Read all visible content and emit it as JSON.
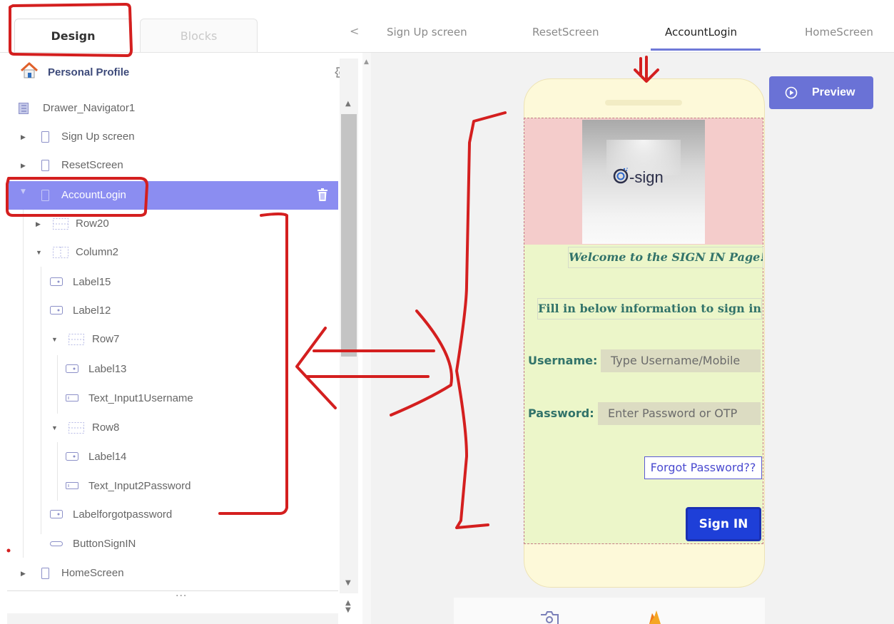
{
  "editor_tabs": {
    "design": "Design",
    "blocks": "Blocks"
  },
  "screen_tabs": {
    "prev_arrow": "<",
    "items": [
      {
        "label": "Sign Up screen"
      },
      {
        "label": "ResetScreen"
      },
      {
        "label": "AccountLogin"
      },
      {
        "label": "HomeScreen"
      }
    ]
  },
  "project": {
    "title": "Personal Profile"
  },
  "tree": {
    "drawer": "Drawer_Navigator1",
    "signup": "Sign Up screen",
    "reset": "ResetScreen",
    "account": "AccountLogin",
    "row20": "Row20",
    "column2": "Column2",
    "label15": "Label15",
    "label12": "Label12",
    "row7": "Row7",
    "label13": "Label13",
    "text1": "Text_Input1Username",
    "row8": "Row8",
    "label14": "Label14",
    "text2": "Text_Input2Password",
    "labelforgot": "Labelforgotpassword",
    "button": "ButtonSignIN",
    "home": "HomeScreen"
  },
  "panel": {
    "more": "..."
  },
  "preview": {
    "label": "Preview"
  },
  "phone": {
    "logo_text": "-sign",
    "welcome": "Welcome to the SIGN IN Page!",
    "fill_in": "Fill in below information to sign in",
    "username_label": "Username:",
    "username_placeholder": "Type Username/Mobile",
    "password_label": "Password:",
    "password_placeholder": "Enter Password or OTP",
    "forgot": "Forgot Password??",
    "signin": "Sign IN"
  },
  "colors": {
    "accent": "#6a72d6",
    "selected_row": "#8b8df1",
    "annotation": "#d41f1f",
    "screen_bg": "#ecf6c9",
    "signin_button": "#1e3fd8"
  },
  "icons": {
    "home": "home-icon",
    "gear": "gear-icon",
    "trash": "trash-icon",
    "play": "play-icon",
    "camera": "camera-icon",
    "firebase": "firebase-icon"
  }
}
